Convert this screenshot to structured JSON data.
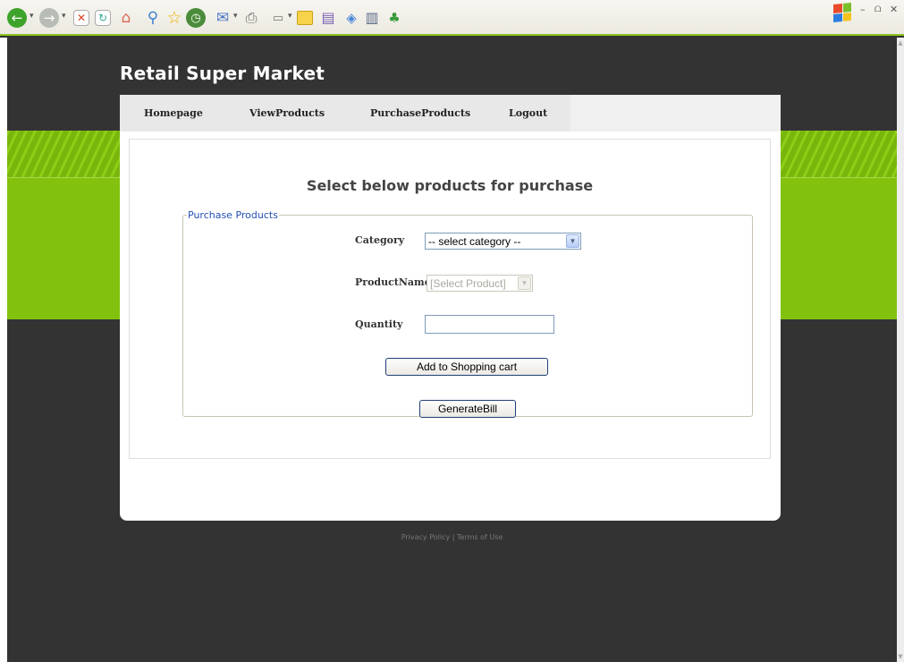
{
  "browser": {
    "toolbar_icons": [
      "back-icon",
      "forward-icon",
      "stop-icon",
      "refresh-icon",
      "home-icon",
      "search-icon",
      "favorites-icon",
      "history-icon",
      "mail-icon",
      "print-icon",
      "edit-icon",
      "folder-icon",
      "messenger-icon",
      "research-icon",
      "book-icon",
      "contacts-icon"
    ],
    "window_controls": {
      "minimize": "–",
      "restore": "ᗝ",
      "close": "✕"
    }
  },
  "site": {
    "title": "Retail Super Market"
  },
  "nav": {
    "items": [
      {
        "label": "Homepage"
      },
      {
        "label": "ViewProducts"
      },
      {
        "label": "PurchaseProducts"
      },
      {
        "label": "Logout"
      }
    ]
  },
  "main": {
    "heading": "Select below products for purchase",
    "fieldset_legend": "Purchase Products",
    "category_label": "Category",
    "category_selected": "-- select category --",
    "product_label": "ProductName",
    "product_selected": "[Select Product]",
    "quantity_label": "Quantity",
    "quantity_value": "",
    "add_to_cart_label": "Add to Shopping cart",
    "generate_bill_label": "GenerateBill"
  },
  "footer": {
    "text": "Privacy Policy | Terms of Use"
  },
  "colors": {
    "accent_green": "#82c20f",
    "dark_bg": "#333333",
    "legend_blue": "#2450b5"
  }
}
